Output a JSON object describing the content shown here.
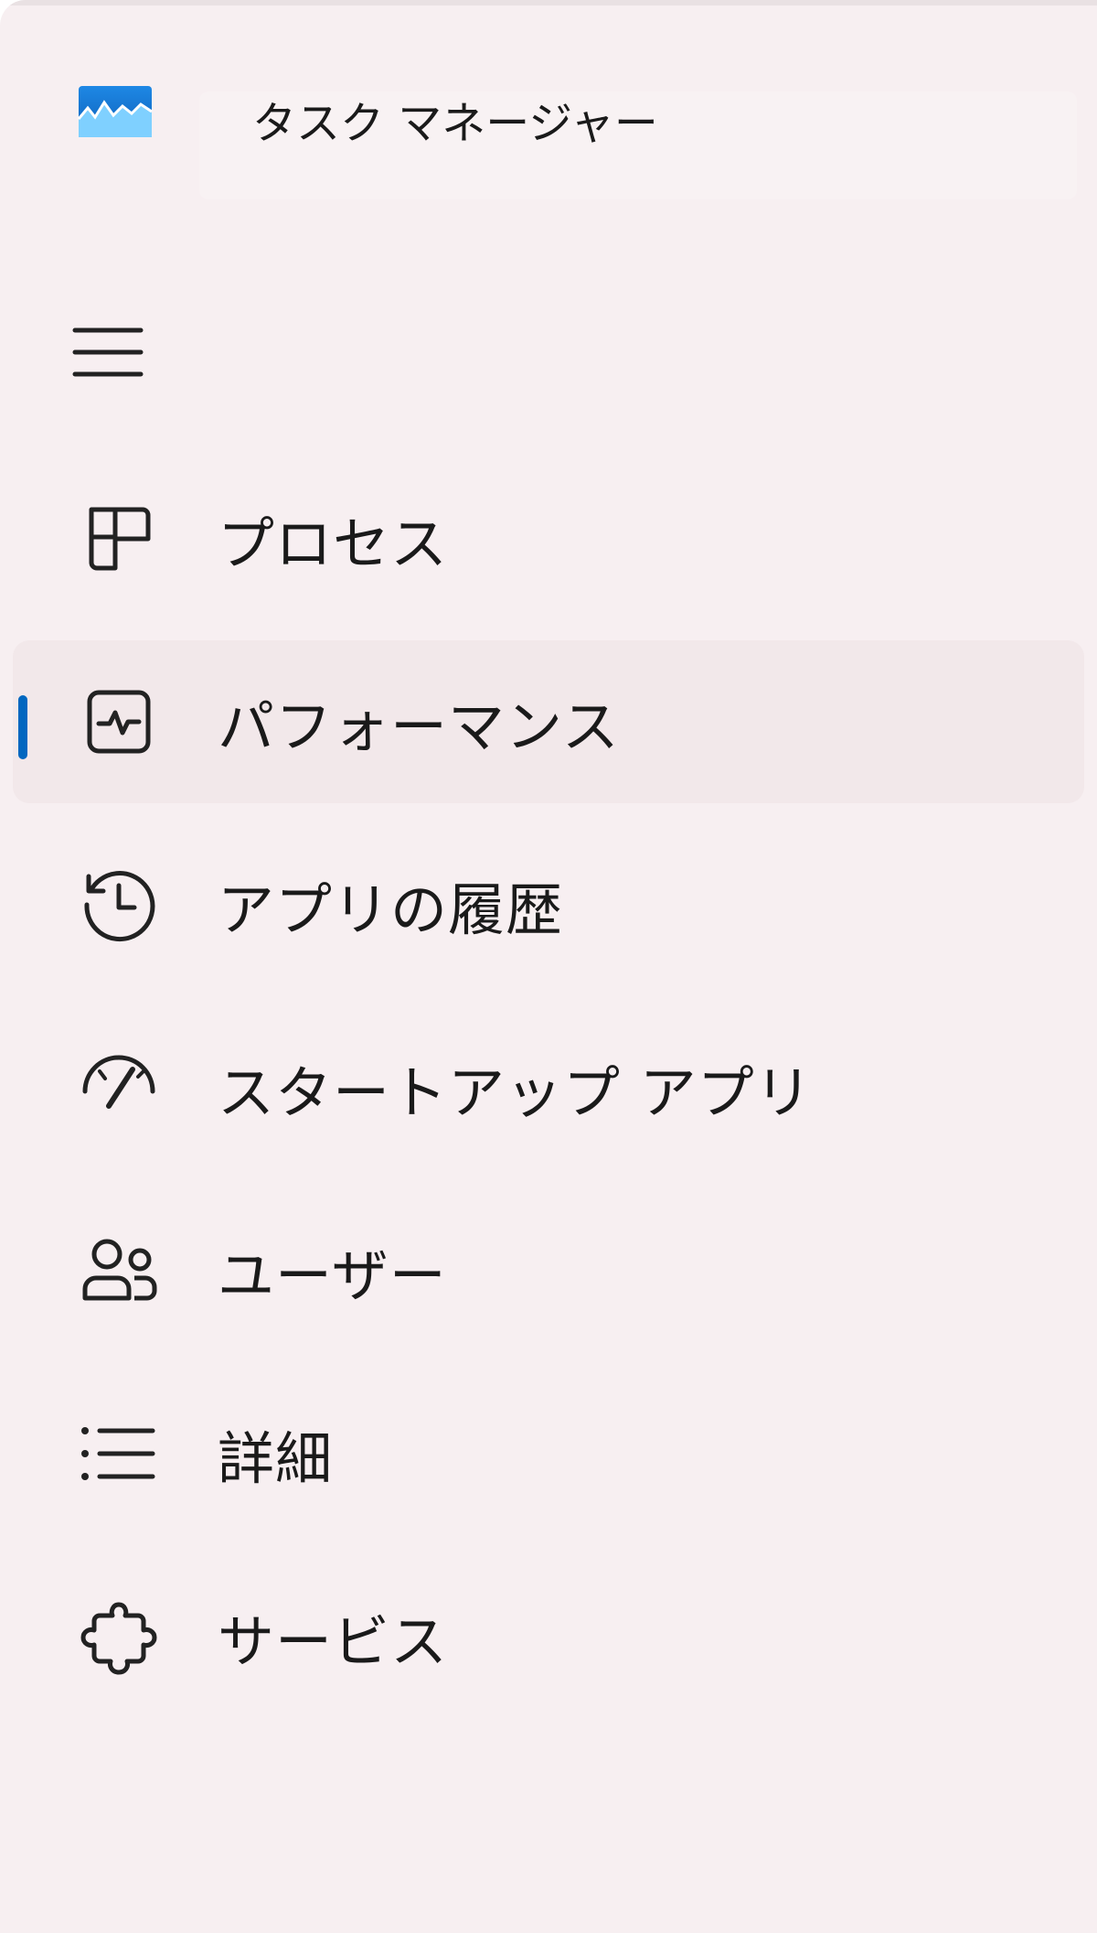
{
  "window": {
    "title": "タスク マネージャー",
    "accent_color": "#0067c0",
    "background_color": "#f7eff1",
    "selected_item_background": "#f2e8ea"
  },
  "titlebar": {
    "app_icon": "task-manager-app-icon"
  },
  "nav": {
    "menu_icon": "hamburger-menu-icon",
    "selected": "performance",
    "items": [
      {
        "id": "processes",
        "label": "プロセス",
        "icon": "grid-icon"
      },
      {
        "id": "performance",
        "label": "パフォーマンス",
        "icon": "activity-icon"
      },
      {
        "id": "app-history",
        "label": "アプリの履歴",
        "icon": "history-icon"
      },
      {
        "id": "startup-apps",
        "label": "スタートアップ アプリ",
        "icon": "speedometer-icon"
      },
      {
        "id": "users",
        "label": "ユーザー",
        "icon": "users-icon"
      },
      {
        "id": "details",
        "label": "詳細",
        "icon": "list-icon"
      },
      {
        "id": "services",
        "label": "サービス",
        "icon": "puzzle-icon"
      }
    ]
  }
}
